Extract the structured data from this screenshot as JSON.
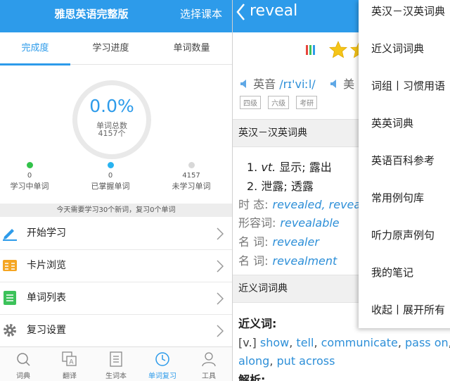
{
  "left": {
    "title": "雅思英语完整版",
    "choose_book": "选择课本",
    "tabs": [
      "完成度",
      "学习进度",
      "单词数量"
    ],
    "progress": {
      "percent": "0.0%",
      "total_label": "单词总数",
      "total_count": "4157个"
    },
    "stats": [
      {
        "count": "0",
        "label": "学习中单词",
        "color": "#33c24a"
      },
      {
        "count": "0",
        "label": "已掌握单词",
        "color": "#29b3f0"
      },
      {
        "count": "4157",
        "label": "未学习单词",
        "color": "#d8d8d8"
      }
    ],
    "notice": "今天需要学习30个新词，复习0个单词",
    "menu": [
      {
        "label": "开始学习",
        "icon": "pencil-icon"
      },
      {
        "label": "卡片浏览",
        "icon": "cards-icon"
      },
      {
        "label": "单词列表",
        "icon": "list-icon"
      },
      {
        "label": "复习设置",
        "icon": "gear-icon"
      }
    ],
    "nav": [
      {
        "label": "词典",
        "icon": "search-icon"
      },
      {
        "label": "翻译",
        "icon": "translate-icon"
      },
      {
        "label": "生词本",
        "icon": "notebook-icon"
      },
      {
        "label": "单词复习",
        "icon": "clock-icon"
      },
      {
        "label": "工具",
        "icon": "person-icon"
      }
    ]
  },
  "right": {
    "word": "reveal",
    "pron_label": "英音",
    "phonetic": "/rɪ'viːl/",
    "pron_label2": "美",
    "tags": [
      "四级",
      "六级",
      "考研"
    ],
    "section1": "英汉－汉英词典",
    "defs": [
      {
        "num": "1.",
        "pos": "vt.",
        "text": "显示; 露出"
      },
      {
        "num": "2.",
        "pos": "",
        "text": "泄露; 透露"
      }
    ],
    "forms": [
      {
        "label": "时 态:",
        "value": "revealed, revea"
      },
      {
        "label": "形容词:",
        "value": "revealable"
      },
      {
        "label": "名 词:",
        "value": "revealer"
      },
      {
        "label": "名 词:",
        "value": "revealment"
      }
    ],
    "section2": "近义词词典",
    "syn_heading": "近义词:",
    "syn_prefix": "[v.]",
    "synonyms": [
      "show",
      "tell",
      "communicate",
      "pass on",
      "p",
      "along",
      "put across"
    ],
    "analysis_heading": "解析:"
  },
  "dropdown": [
    "英汉－汉英词典",
    "近义词词典",
    "词组丨习惯用语",
    "英英词典",
    "英语百科参考",
    "常用例句库",
    "听力原声例句",
    "我的笔记",
    "收起丨展开所有"
  ],
  "colors": {
    "accent": "#2d9bea",
    "link": "#2d8fd8"
  }
}
